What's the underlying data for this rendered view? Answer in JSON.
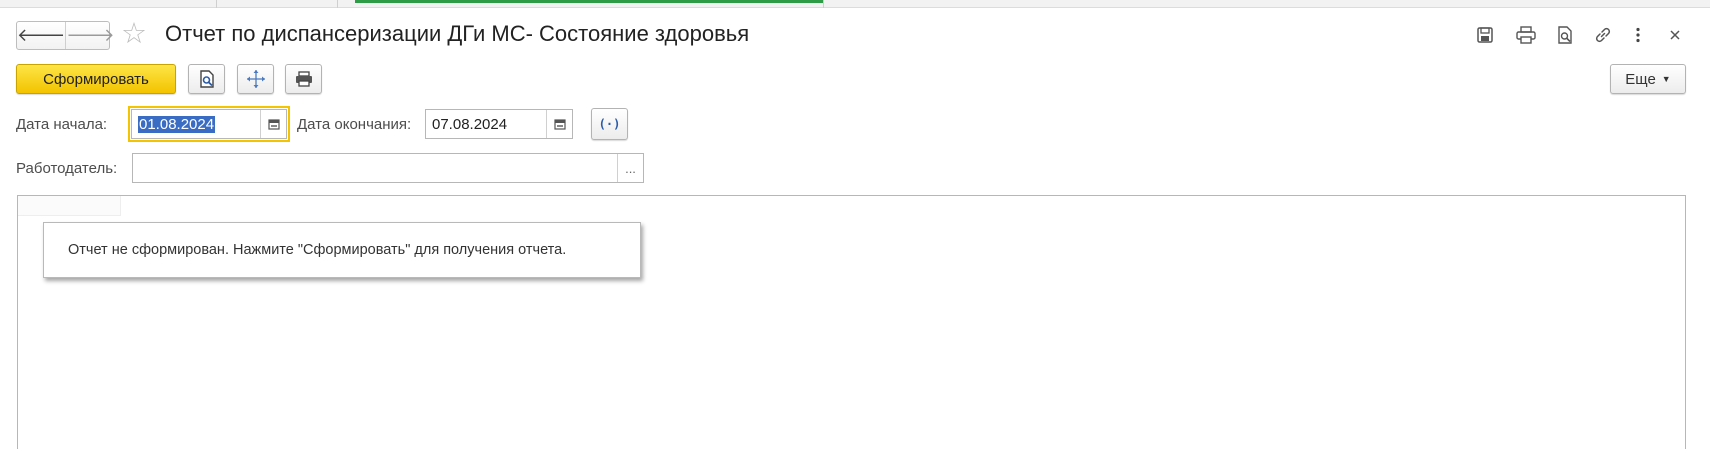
{
  "window": {
    "title": "Отчет по диспансеризации ДГи МС- Состояние здоровья",
    "nav_back_icon": "arrow-left-icon",
    "nav_forward_icon": "arrow-right-icon",
    "favorite_icon": "star-icon",
    "header_icons": [
      "save-icon",
      "print-icon",
      "preview-icon",
      "link-icon",
      "more-vertical-icon",
      "close-icon"
    ]
  },
  "toolbar": {
    "generate_label": "Сформировать",
    "preview_icon": "preview-icon",
    "move_icon": "move-icon",
    "print_icon": "print-icon",
    "more_label": "Еще"
  },
  "filters": {
    "start_date_label": "Дата начала:",
    "start_date_value": "01.08.2024",
    "end_date_label": "Дата окончания:",
    "end_date_value": "07.08.2024",
    "period_icon": "period-select-icon",
    "employer_label": "Работодатель:",
    "employer_value": "",
    "employer_select_label": "..."
  },
  "report": {
    "notice": "Отчет не сформирован. Нажмите \"Сформировать\" для получения отчета."
  },
  "colors": {
    "primary_button": "#f3c300",
    "focus_outline": "#f5c400",
    "selection": "#3b6cc4",
    "active_tab": "#2e9b47"
  }
}
